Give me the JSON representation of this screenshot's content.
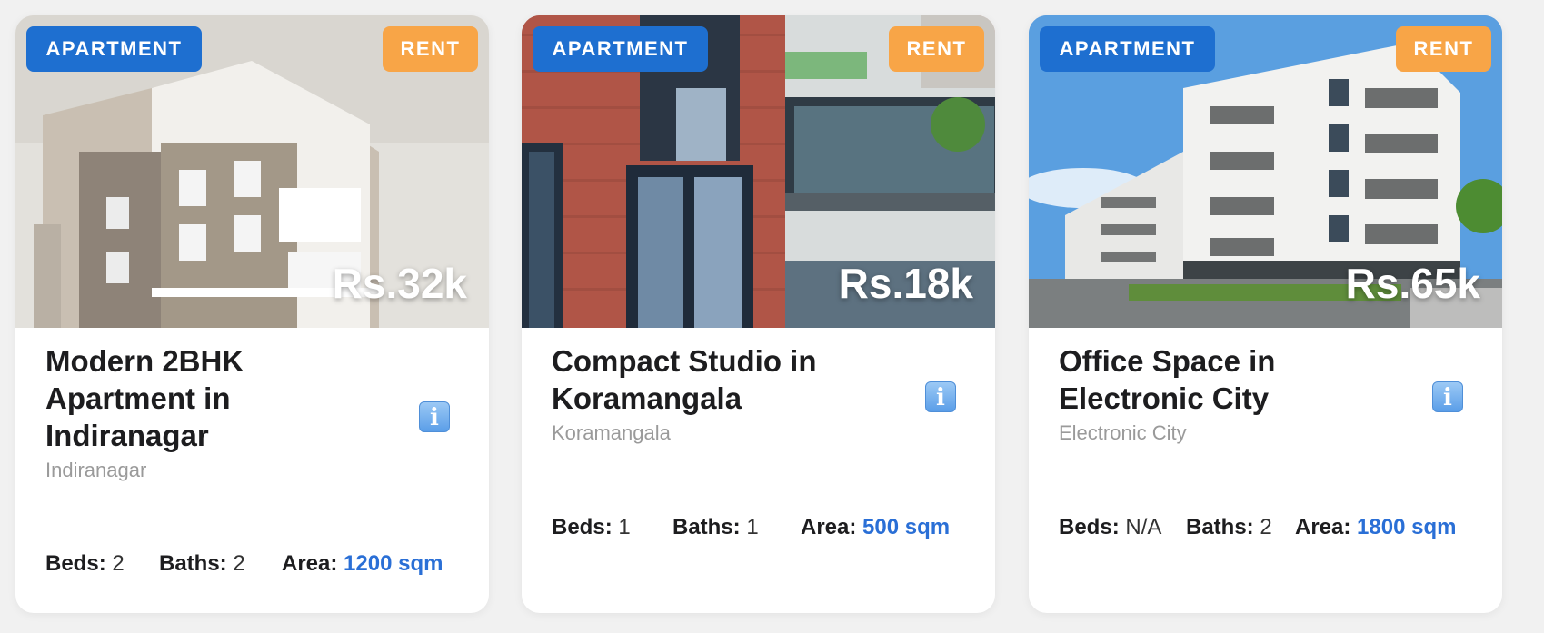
{
  "listings": [
    {
      "type_badge": "APARTMENT",
      "mode_badge": "RENT",
      "price": "Rs.32k",
      "title": "Modern 2BHK Apartment in Indiranagar",
      "locality": "Indiranagar",
      "info_icon": "info-icon",
      "stats": {
        "beds_label": "Beds:",
        "beds": "2",
        "baths_label": "Baths:",
        "baths": "2",
        "area_label": "Area:",
        "area": "1200 sqm"
      }
    },
    {
      "type_badge": "APARTMENT",
      "mode_badge": "RENT",
      "price": "Rs.18k",
      "title": "Compact Studio in Koramangala",
      "locality": "Koramangala",
      "info_icon": "info-icon",
      "stats": {
        "beds_label": "Beds:",
        "beds": "1",
        "baths_label": "Baths:",
        "baths": "1",
        "area_label": "Area:",
        "area": "500 sqm"
      }
    },
    {
      "type_badge": "APARTMENT",
      "mode_badge": "RENT",
      "price": "Rs.65k",
      "title": "Office Space in Electronic City",
      "locality": "Electronic City",
      "info_icon": "info-icon",
      "stats": {
        "beds_label": "Beds:",
        "beds": "N/A",
        "baths_label": "Baths:",
        "baths": "2",
        "area_label": "Area:",
        "area": "1800 sqm"
      }
    }
  ],
  "colors": {
    "type_badge": "#1e6fd0",
    "mode_badge": "#f8a547",
    "area_value": "#2a6fd6",
    "locality_text": "#9a9a9a"
  }
}
